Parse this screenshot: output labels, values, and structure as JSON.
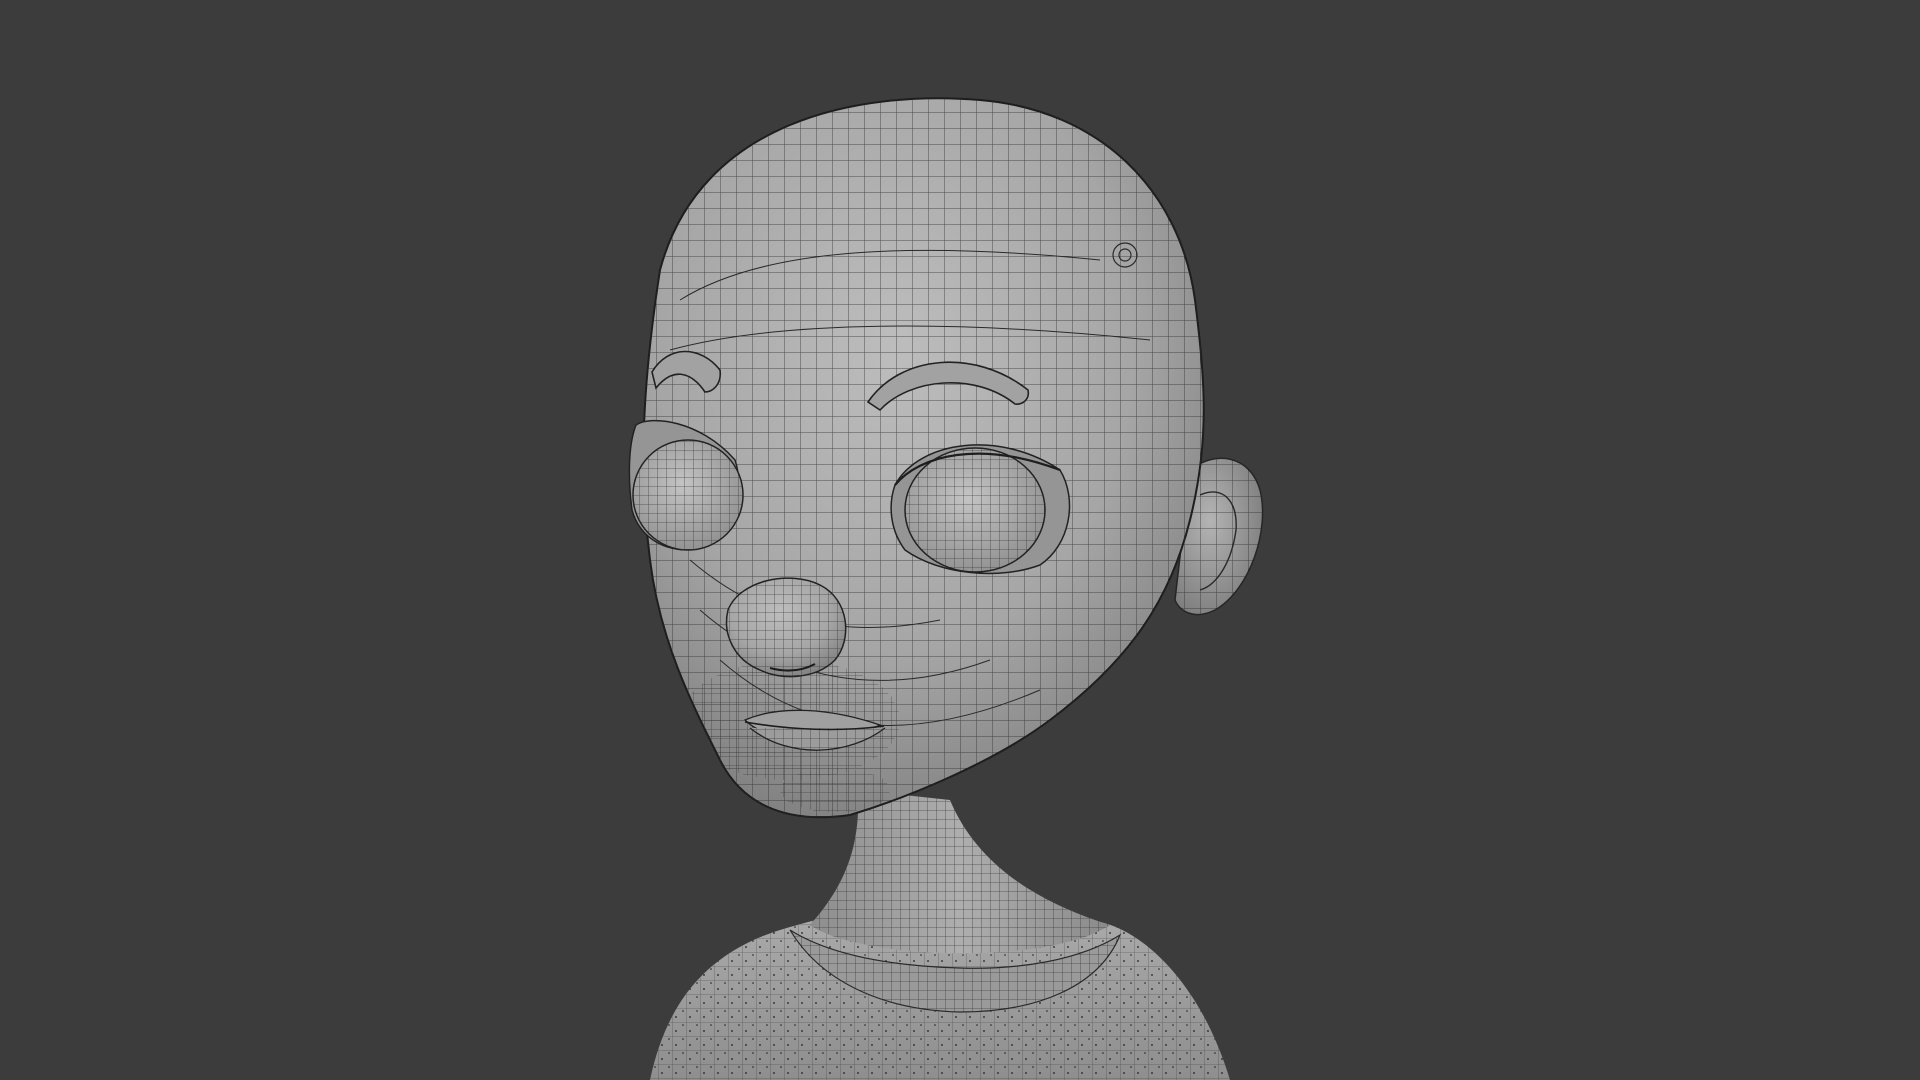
{
  "scene": {
    "background_color": "#3c3c3c",
    "mesh_color": "#a9a9a9",
    "mesh_shadow_color": "#7d7d7d",
    "wire_color": "#2a2a2a",
    "display_mode": "wireframe-on-shaded",
    "subject": "stylized-character-head-bust"
  }
}
